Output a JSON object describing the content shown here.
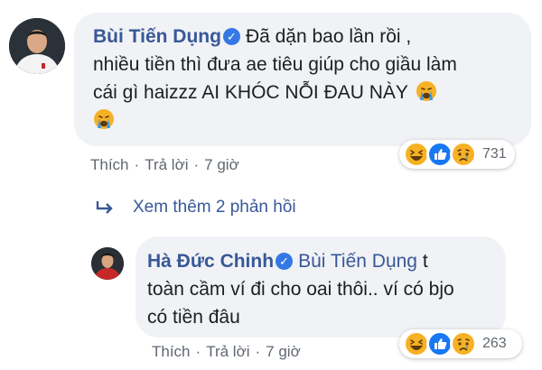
{
  "comment1": {
    "author": "Bùi Tiến Dụng",
    "text_lines": [
      "Đã dặn bao lần rồi ,",
      "nhiều tiền thì đưa ae tiêu giúp cho giầu làm",
      "cái gì haizzz AI KHÓC NỖI ĐAU NÀY"
    ],
    "like_label": "Thích",
    "reply_label": "Trả lời",
    "time": "7 giờ",
    "reaction_count": "731",
    "reaction_icons": [
      "haha-icon",
      "like-icon",
      "sad-icon"
    ]
  },
  "view_more": {
    "label": "Xem thêm 2 phản hồi"
  },
  "comment2": {
    "author": "Hà Đức Chinh",
    "mention": "Bùi Tiến Dụng",
    "text_lines": [
      "t",
      "toàn cầm ví đi cho oai thôi.. ví có bjo",
      "có tiền đâu"
    ],
    "like_label": "Thích",
    "reply_label": "Trả lời",
    "time": "7 giờ",
    "reaction_count": "263",
    "reaction_icons": [
      "haha-icon",
      "like-icon",
      "sad-icon"
    ]
  },
  "colors": {
    "name_link": "#385898",
    "verified": "#3578e5",
    "bubble_bg": "#f0f2f5",
    "meta_text": "#606770",
    "like_blue": "#1877f2",
    "emoji_yellow": "#f7b125"
  }
}
